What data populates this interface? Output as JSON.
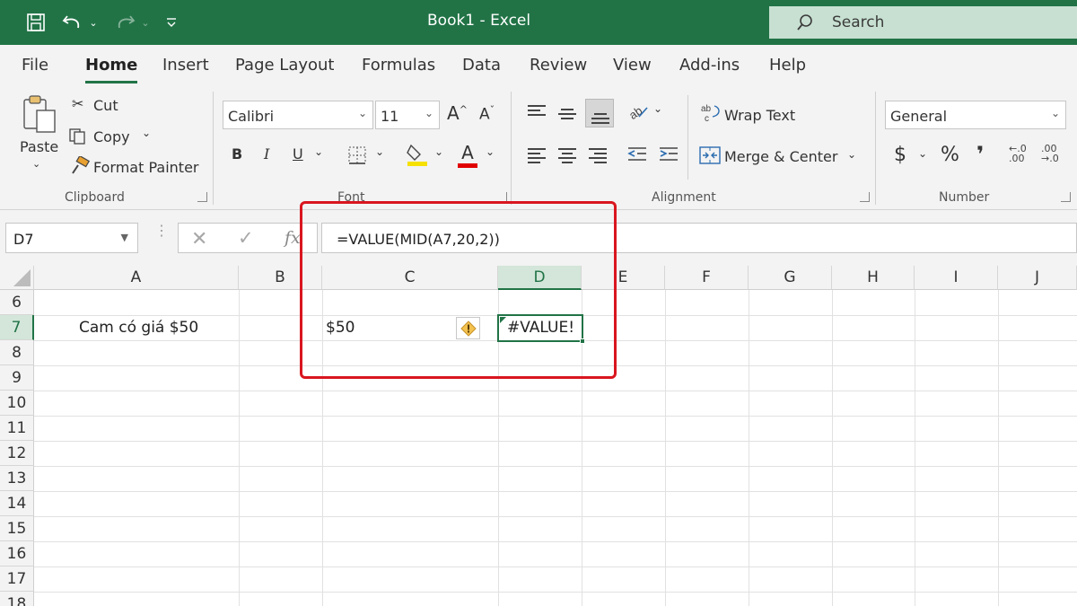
{
  "window": {
    "title": "Book1  -  Excel"
  },
  "search": {
    "placeholder": "Search"
  },
  "menu": {
    "tabs": [
      "File",
      "Home",
      "Insert",
      "Page Layout",
      "Formulas",
      "Data",
      "Review",
      "View",
      "Add-ins",
      "Help"
    ],
    "active": "Home"
  },
  "ribbon": {
    "clipboard": {
      "paste": "Paste",
      "cut": "Cut",
      "copy": "Copy",
      "format_painter": "Format Painter",
      "label": "Clipboard"
    },
    "font": {
      "family": "Calibri",
      "size": "11",
      "label": "Font",
      "bold": "B",
      "italic": "I",
      "underline": "U",
      "grow": "A",
      "shrink": "A",
      "color_letter": "A",
      "highlight_color": "#f5e000",
      "font_color": "#e00000"
    },
    "alignment": {
      "wrap_text": "Wrap Text",
      "merge_center": "Merge & Center",
      "label": "Alignment"
    },
    "number": {
      "format": "General",
      "currency": "$",
      "percent": "%",
      "comma": "❜",
      "label": "Number",
      "inc_decimal": ".00",
      "dec_decimal": ".0"
    }
  },
  "formula_bar": {
    "name_box": "D7",
    "formula": "=VALUE(MID(A7,20,2))",
    "fx": "fx"
  },
  "sheet": {
    "columns": [
      "A",
      "B",
      "C",
      "D",
      "E",
      "F",
      "G",
      "H",
      "I",
      "J"
    ],
    "selected_column": "D",
    "rows": [
      "6",
      "7",
      "8",
      "9",
      "10",
      "11",
      "12",
      "13",
      "14",
      "15",
      "16",
      "17",
      "18"
    ],
    "selected_row": "7",
    "cells": {
      "A7": "Cam có giá $50",
      "C7": "$50",
      "D7": "#VALUE!"
    },
    "accent": "#217346",
    "highlight_box_color": "#d9161f"
  }
}
